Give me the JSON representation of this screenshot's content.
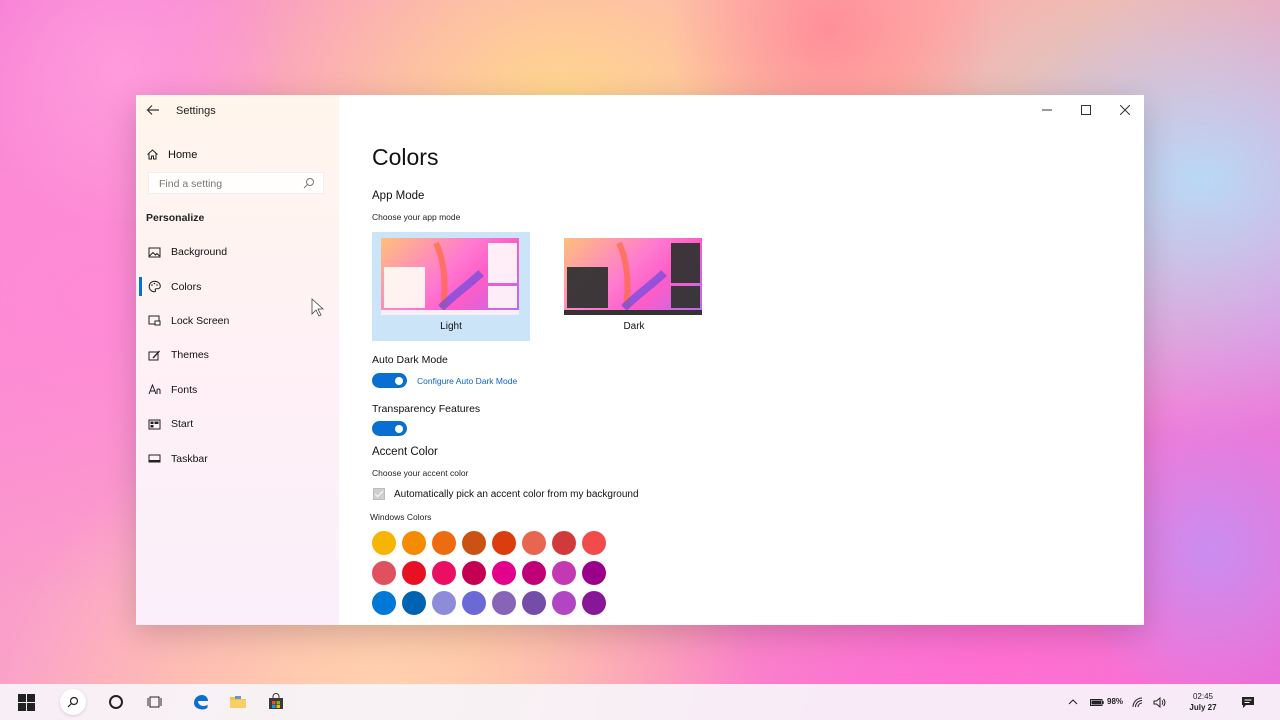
{
  "window": {
    "app_title": "Settings",
    "sidebar": {
      "home_label": "Home",
      "search_placeholder": "Find a setting",
      "section_label": "Personalize",
      "items": [
        {
          "label": "Background",
          "icon": "image-icon"
        },
        {
          "label": "Colors",
          "icon": "palette-icon",
          "active": true
        },
        {
          "label": "Lock Screen",
          "icon": "lock-screen-icon"
        },
        {
          "label": "Themes",
          "icon": "brush-icon"
        },
        {
          "label": "Fonts",
          "icon": "font-icon"
        },
        {
          "label": "Start",
          "icon": "start-icon"
        },
        {
          "label": "Taskbar",
          "icon": "taskbar-icon"
        }
      ]
    },
    "main": {
      "title": "Colors",
      "app_mode": {
        "heading": "App Mode",
        "caption": "Choose your app mode",
        "options": [
          {
            "label": "Light",
            "selected": true
          },
          {
            "label": "Dark",
            "selected": false
          }
        ]
      },
      "auto_dark_mode": {
        "heading": "Auto Dark Mode",
        "enabled": true,
        "link": "Configure Auto Dark Mode"
      },
      "transparency": {
        "heading": "Transparency Features",
        "enabled": true
      },
      "accent_color": {
        "heading": "Accent Color",
        "caption": "Choose your accent color",
        "auto_pick_label": "Automatically pick an accent color from my background",
        "auto_pick_checked": true,
        "palette_label": "Windows Colors",
        "swatches": [
          [
            "#f7b400",
            "#f48b00",
            "#ef6b0f",
            "#ca5213",
            "#db3d0e",
            "#e8654f",
            "#d13a3a",
            "#f24b4b"
          ],
          [
            "#e0505f",
            "#e81123",
            "#ea0f63",
            "#c30052",
            "#e3008c",
            "#bf0077",
            "#c239b3",
            "#9a0089"
          ],
          [
            "#0078d7",
            "#0063b1",
            "#8e8cd8",
            "#6b69d6",
            "#8764b8",
            "#744da9",
            "#b146c2",
            "#881798"
          ]
        ]
      }
    }
  },
  "taskbar": {
    "battery_percent": "98%",
    "time": "02:45",
    "date": "July 27"
  },
  "colors": {
    "accent": "#0a6fd0"
  }
}
